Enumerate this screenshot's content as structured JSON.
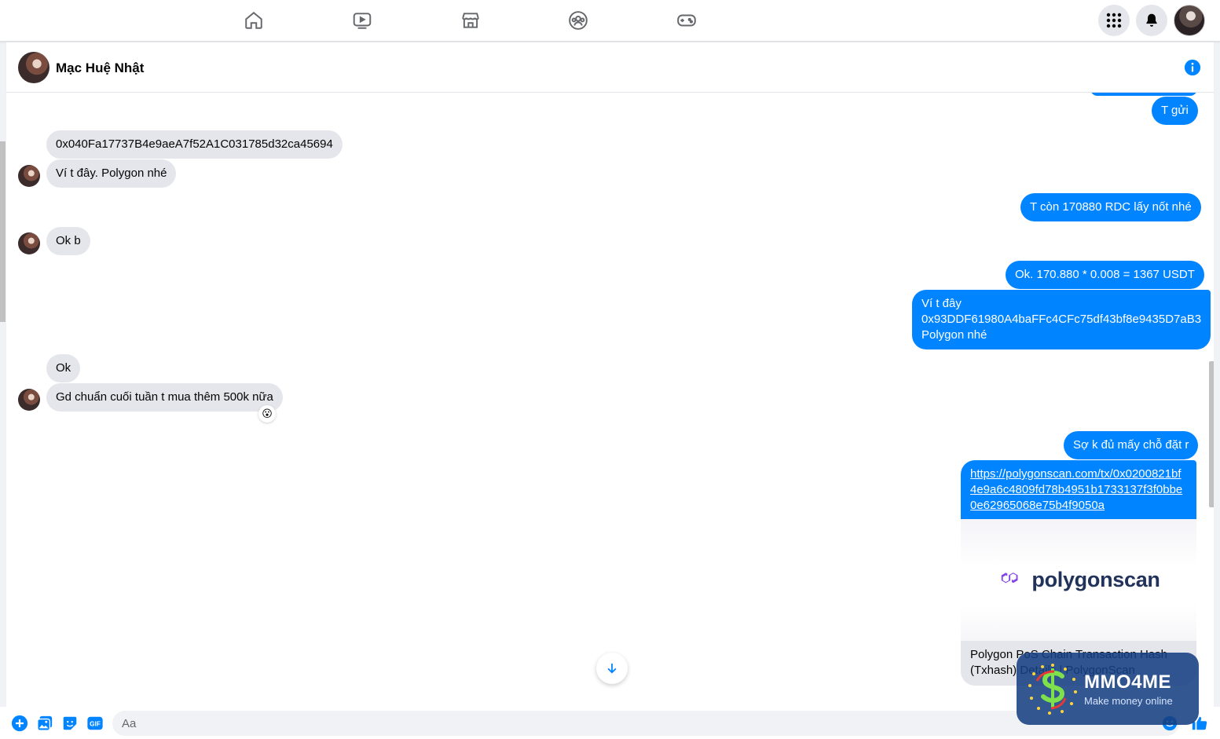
{
  "chat": {
    "contact_name": "Mạc Huệ Nhật"
  },
  "messages": [
    {
      "dir": "out",
      "text": "T gửi"
    },
    {
      "dir": "in",
      "text": "0x040Fa17737B4e9aeA7f52A1C031785d32ca45694"
    },
    {
      "dir": "in",
      "text": "Ví t đây. Polygon nhé"
    },
    {
      "dir": "out",
      "text": "T còn 170880 RDC lấy nốt nhé"
    },
    {
      "dir": "in",
      "text": "Ok b"
    },
    {
      "dir": "out",
      "text": "Ok. 170.880 * 0.008 = 1367 USDT"
    },
    {
      "dir": "out",
      "lines": [
        "Ví t đây",
        "0x93DDF61980A4baFFc4CFc75df43bf8e9435D7aB3",
        "Polygon nhé"
      ]
    },
    {
      "dir": "in",
      "text": "Ok"
    },
    {
      "dir": "in",
      "text": "Gd chuẩn cuối tuần t mua thêm 500k nữa",
      "reaction": "😮"
    },
    {
      "dir": "out",
      "text": "Sợ k đủ mấy chỗ đặt r"
    },
    {
      "dir": "out",
      "link": "https://polygonscan.com/tx/0x0200821bf4e9a6c4809fd78b4951b1733137f3f0bbe0e62965068e75b4f9050a"
    }
  ],
  "link_preview": {
    "brand": "polygonscan",
    "title": "Polygon PoS Chain Transaction Hash (Txhash) Details | PolygonScan"
  },
  "composer": {
    "placeholder": "Aa"
  },
  "watermark": {
    "title": "MMO4ME",
    "subtitle": "Make money online"
  },
  "colors": {
    "accent": "#0084ff",
    "incoming_bubble": "#e4e6eb",
    "polygon_purple": "#8247e5"
  },
  "icons": {
    "nav": [
      "home-icon",
      "watch-icon",
      "marketplace-icon",
      "groups-icon",
      "gaming-icon"
    ],
    "top_right": [
      "menu-grid-icon",
      "notifications-bell-icon",
      "profile-avatar"
    ],
    "composer": [
      "plus-icon",
      "photo-icon",
      "sticker-icon",
      "gif-icon",
      "emoji-icon",
      "like-thumb-icon"
    ]
  }
}
